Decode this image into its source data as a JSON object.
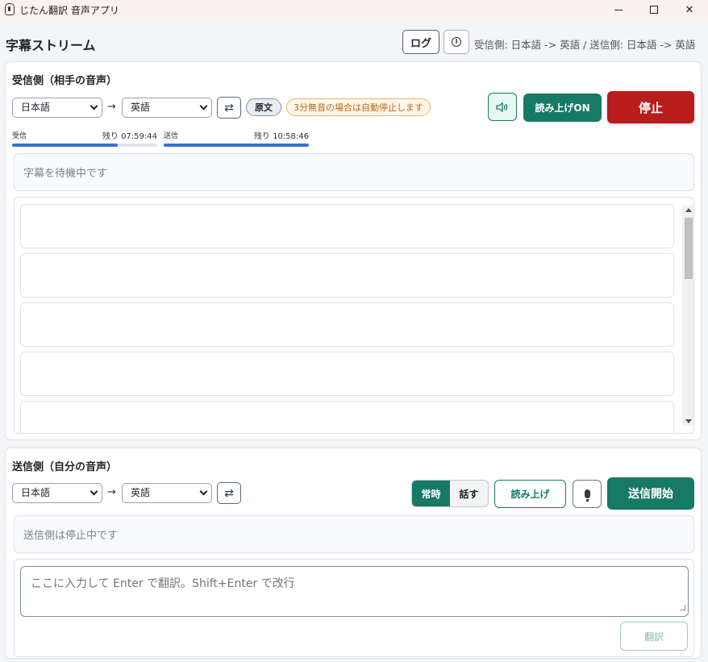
{
  "window": {
    "title": "じたん翻訳 音声アプリ"
  },
  "header": {
    "title": "字幕ストリーム",
    "log_label": "ログ",
    "info_glyph": "i",
    "direction_info": "受信側: 日本語 -> 英語 / 送信側: 日本語 -> 英語"
  },
  "receive": {
    "title": "受信側（相手の音声）",
    "source_lang": "日本語",
    "target_lang": "英語",
    "arrow": "→",
    "swap_glyph": "⇄",
    "original_label": "原文",
    "silence_notice": "3分無音の場合は自動停止します",
    "read_aloud_label": "読み上げON",
    "stop_label": "停止",
    "meters": [
      {
        "label": "受信",
        "remaining": "残り 07:59:44",
        "progress": 0.73
      },
      {
        "label": "送信",
        "remaining": "残り 10:58:46",
        "progress": 1.0
      }
    ],
    "status": "字幕を待機中です",
    "subtitle_items": [
      "",
      "",
      "",
      "",
      ""
    ]
  },
  "send": {
    "title": "送信側（自分の音声）",
    "source_lang": "日本語",
    "target_lang": "英語",
    "arrow": "→",
    "swap_glyph": "⇄",
    "mode_always": "常時",
    "mode_talk": "話す",
    "read_aloud_label": "読み上げ",
    "start_label": "送信開始",
    "status": "送信側は停止中です",
    "input_placeholder": "ここに入力して Enter で翻訳。Shift+Enter で改行",
    "translate_label": "翻訳"
  },
  "colors": {
    "accent": "#167a66",
    "danger": "#b91c1c",
    "meter": "#3b6fd8",
    "warn": "#b96a12"
  }
}
